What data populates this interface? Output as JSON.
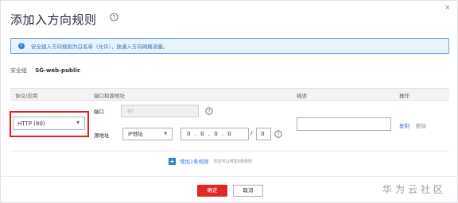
{
  "dialog": {
    "title": "添加入方向规则",
    "close_glyph": "×"
  },
  "notice": {
    "text": "安全组入方向规则为白名单（允许），放通入方向网络流量。"
  },
  "security_group": {
    "label": "安全组",
    "value": "SG-web-public"
  },
  "table": {
    "headers": {
      "protocol": "协议/应用",
      "port_source": "端口和源地址",
      "description": "描述",
      "actions": "操作"
    }
  },
  "rule": {
    "protocol_value": "HTTP (80)",
    "port_label": "端口",
    "port_value": "80",
    "source_label": "源地址",
    "address_type": "IP地址",
    "ip_value": "0 . 0 . 0 . 0",
    "slash": "/",
    "mask_value": "0",
    "description_value": "",
    "copy_label": "复制",
    "delete_label": "删除"
  },
  "add_rule": {
    "plus_glyph": "+",
    "label": "增加1条规则",
    "hint": "您还可以增加9条规则"
  },
  "footer": {
    "ok_label": "确定",
    "cancel_label": "取消"
  },
  "watermark": "华为云社区",
  "colors": {
    "primary_red": "#e02828",
    "highlight_red": "#e02020",
    "link_blue": "#2f80d3",
    "notice_bg": "#eaf3fd"
  }
}
